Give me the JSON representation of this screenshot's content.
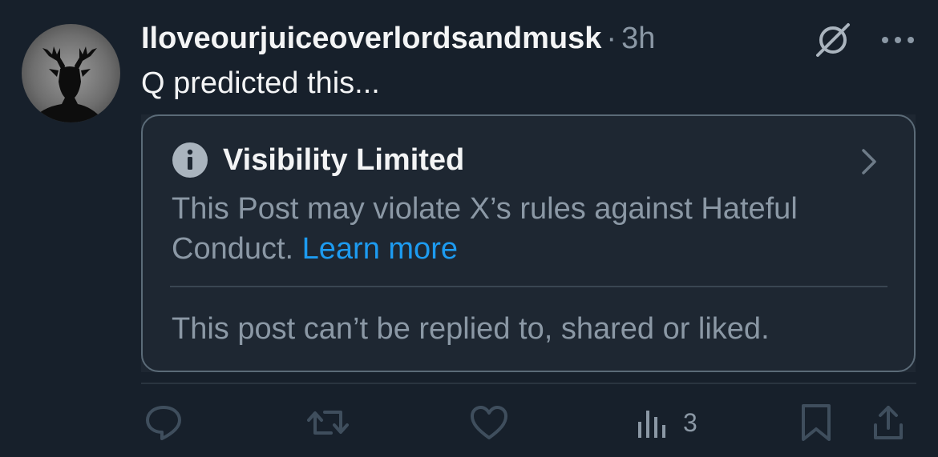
{
  "post": {
    "username": "Iloveourjuiceoverlordsandmusk",
    "separator": "·",
    "time": "3h",
    "text": "Q predicted this..."
  },
  "notice": {
    "title": "Visibility Limited",
    "body": "This Post may violate X’s rules against Hateful Conduct.",
    "link": "Learn more",
    "restriction": "This post can’t be replied to, shared or liked."
  },
  "actions": {
    "views_count": "3"
  },
  "icons": [
    "grok-icon",
    "more-icon",
    "info-icon",
    "chevron-right-icon",
    "reply-icon",
    "repost-icon",
    "like-icon",
    "views-icon",
    "bookmark-icon",
    "share-icon"
  ],
  "colors": {
    "background": "#17202b",
    "card_background": "#1e2732",
    "secondary_text": "#8b98a5",
    "link": "#1d9bf0",
    "action_icon": "#3f4e5d"
  }
}
